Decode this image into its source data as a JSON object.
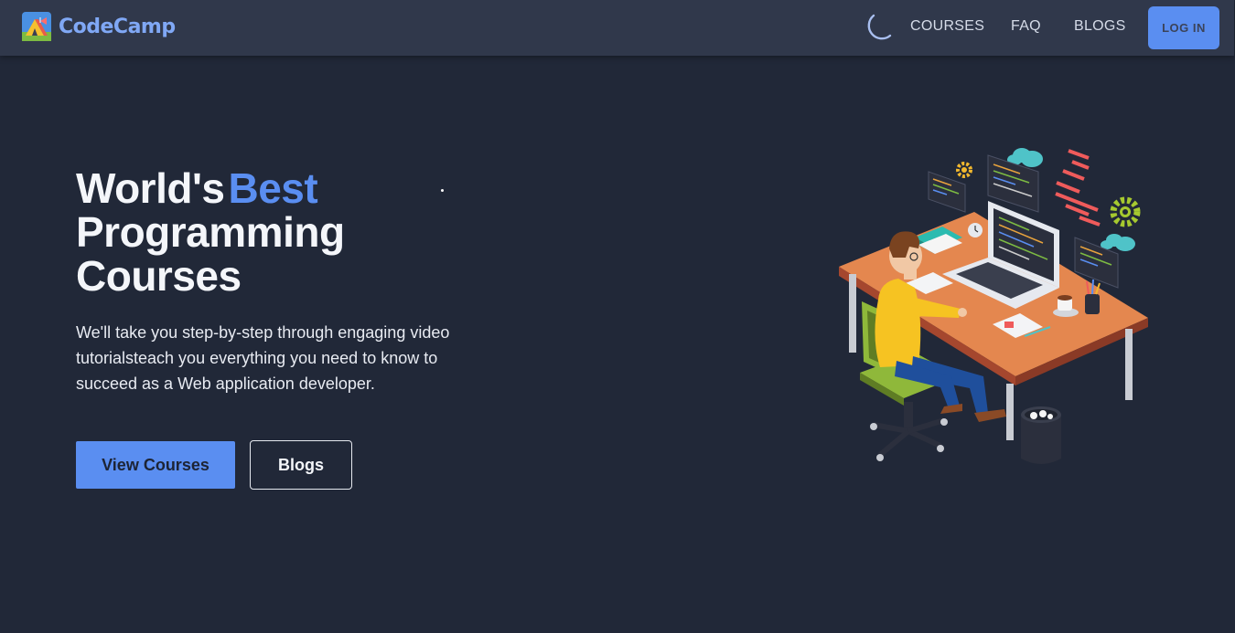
{
  "nav": {
    "brand": "CodeCamp",
    "links": [
      "COURSES",
      "FAQ",
      "BLOGS"
    ],
    "login": "LOG IN"
  },
  "hero": {
    "title_part1": "World's",
    "title_accent": "Best",
    "title_line2": "Programming",
    "title_line3": "Courses",
    "description": "We'll take you step-by-step through engaging video tutorialsteach you everything you need to know to succeed as a Web application developer.",
    "primary_button": "View Courses",
    "secondary_button": "Blogs"
  },
  "colors": {
    "background": "#212838",
    "navbar": "#30384b",
    "accent": "#5a8ef1"
  }
}
